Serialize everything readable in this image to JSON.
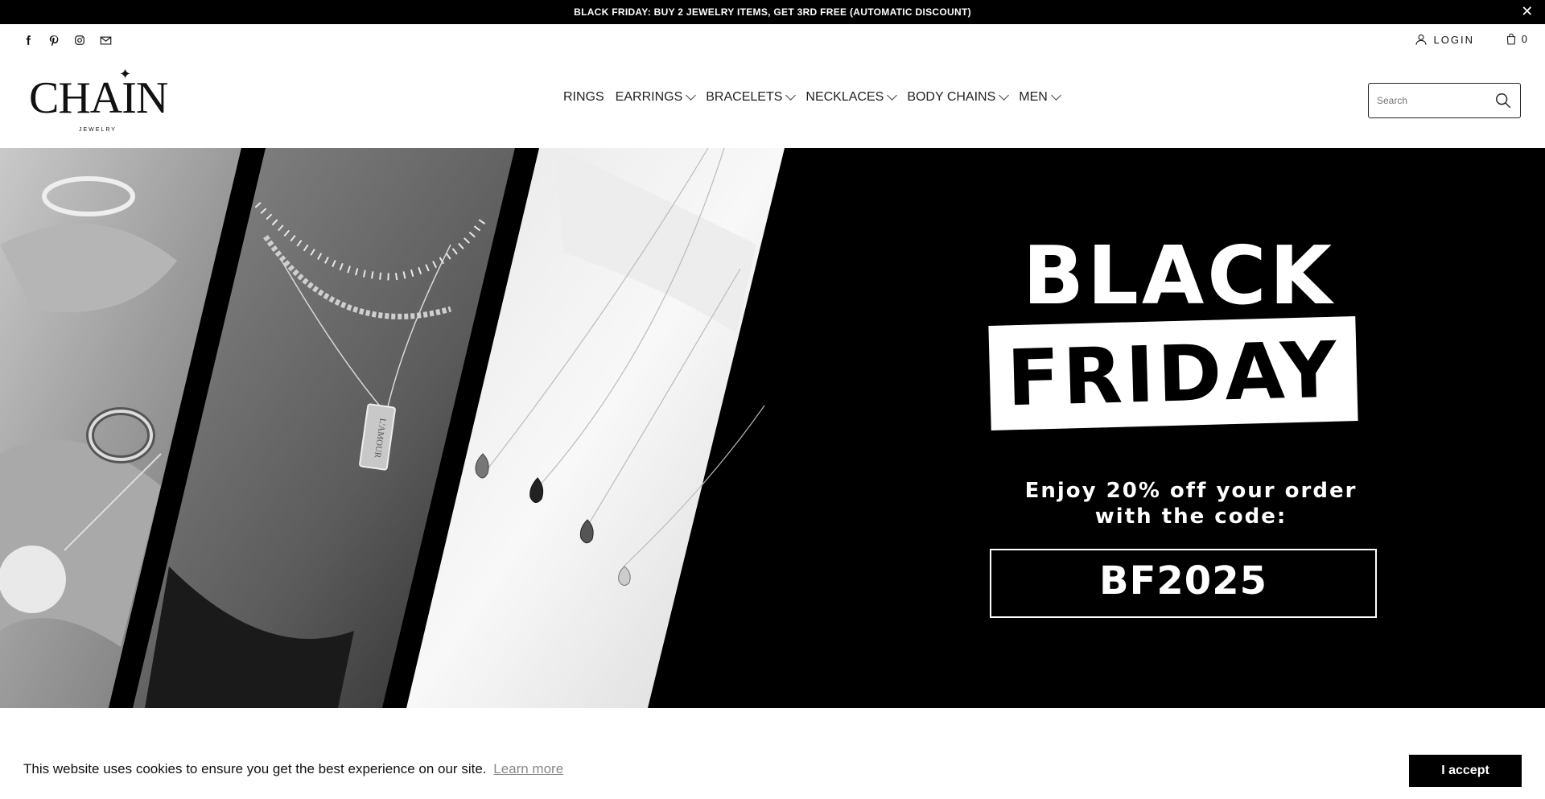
{
  "announcement": {
    "text": "BLACK FRIDAY: BUY 2 JEWELRY ITEMS, GET 3RD FREE (AUTOMATIC DISCOUNT)",
    "close_label": "✕"
  },
  "social_icons": [
    "facebook-icon",
    "pinterest-icon",
    "instagram-icon",
    "mail-icon"
  ],
  "account": {
    "login_label": "LOGIN",
    "cart_count": "0"
  },
  "logo": {
    "text": "CHAIN",
    "subtitle": "JEWELRY"
  },
  "nav": {
    "items": [
      {
        "label": "RINGS",
        "dropdown": false
      },
      {
        "label": "EARRINGS",
        "dropdown": true
      },
      {
        "label": "BRACELETS",
        "dropdown": true
      },
      {
        "label": "NECKLACES",
        "dropdown": true
      },
      {
        "label": "BODY CHAINS",
        "dropdown": true
      },
      {
        "label": "MEN",
        "dropdown": true
      }
    ]
  },
  "search": {
    "placeholder": "Search"
  },
  "hero": {
    "line1": "BLACK",
    "line2": "FRIDAY",
    "offer": "Enjoy 20% off your order with the code:",
    "code": "BF2025",
    "pendant_engraving": "L'AMOUR"
  },
  "cookie": {
    "message": "This website uses cookies to ensure you get the best experience on our site.",
    "learn_more": "Learn more",
    "accept": "I accept"
  },
  "colors": {
    "bar": "#000000",
    "text": "#111111",
    "accent": "#ffffff",
    "link_muted": "#888888"
  }
}
